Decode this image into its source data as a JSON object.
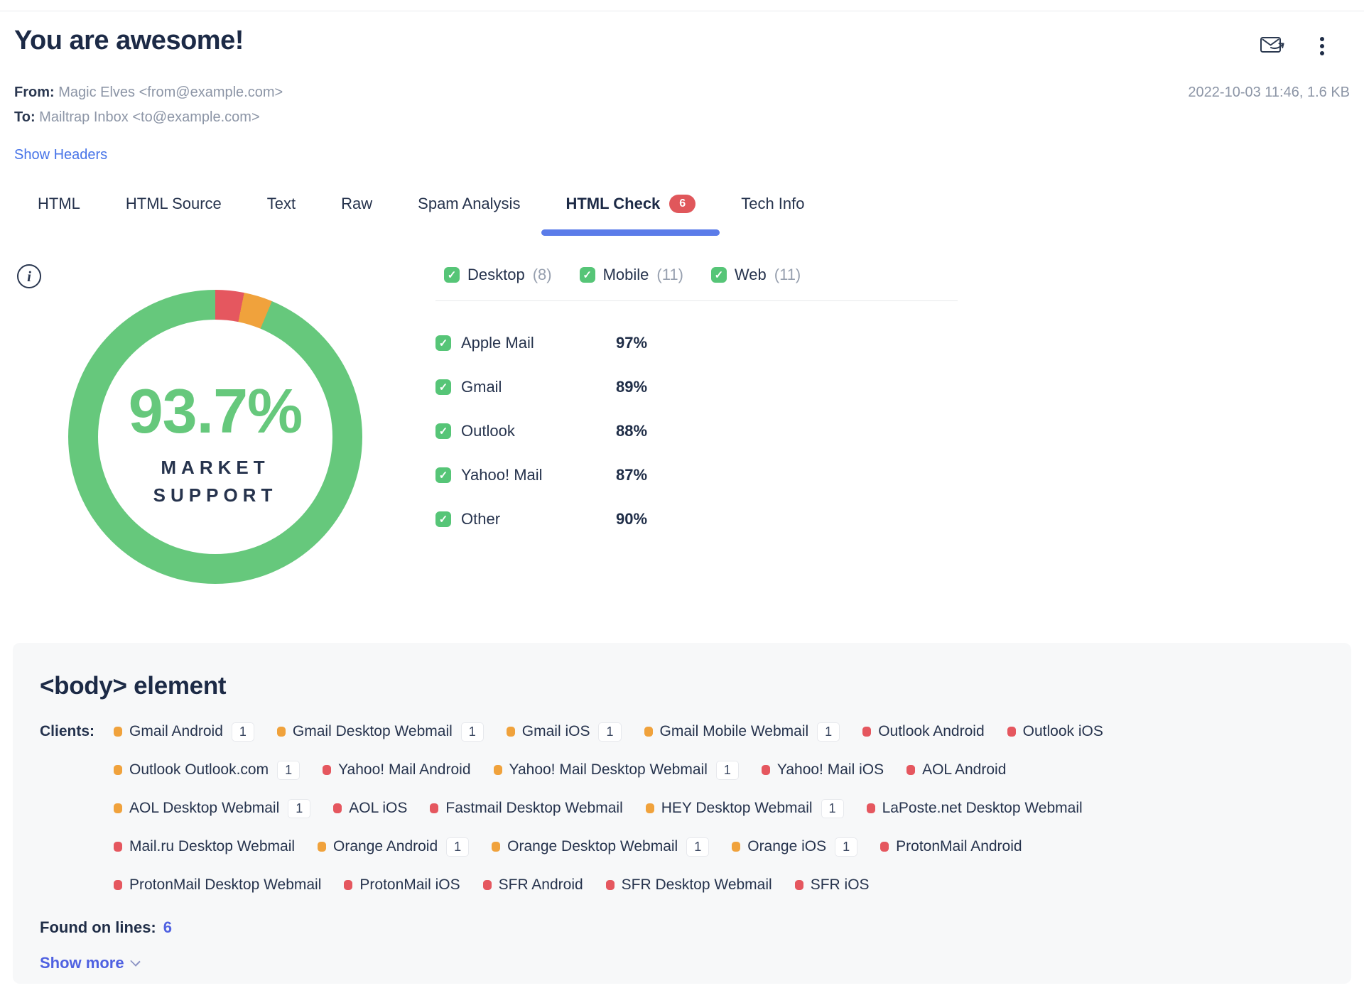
{
  "header": {
    "title": "You are awesome!",
    "from_label": "From:",
    "from_value": "Magic Elves <from@example.com>",
    "to_label": "To:",
    "to_value": "Mailtrap Inbox <to@example.com>",
    "show_headers_link": "Show Headers",
    "timestamp": "2022-10-03 11:46, 1.6 KB"
  },
  "tabs": [
    {
      "label": "HTML",
      "active": false
    },
    {
      "label": "HTML Source",
      "active": false
    },
    {
      "label": "Text",
      "active": false
    },
    {
      "label": "Raw",
      "active": false
    },
    {
      "label": "Spam Analysis",
      "active": false
    },
    {
      "label": "HTML Check",
      "badge": "6",
      "active": true
    },
    {
      "label": "Tech Info",
      "active": false
    }
  ],
  "html_check": {
    "filters": [
      {
        "label": "Desktop",
        "count": "(8)",
        "checked": true
      },
      {
        "label": "Mobile",
        "count": "(11)",
        "checked": true
      },
      {
        "label": "Web",
        "count": "(11)",
        "checked": true
      }
    ],
    "support_list": [
      {
        "label": "Apple Mail",
        "checked": true,
        "value": "97%"
      },
      {
        "label": "Gmail",
        "checked": true,
        "value": "89%"
      },
      {
        "label": "Outlook",
        "checked": true,
        "value": "88%"
      },
      {
        "label": "Yahoo! Mail",
        "checked": true,
        "value": "87%"
      },
      {
        "label": "Other",
        "checked": true,
        "value": "90%"
      }
    ]
  },
  "chart_data": {
    "type": "pie",
    "title": "Market support donut",
    "center_value": "93.7%",
    "center_label": "MARKET SUPPORT",
    "start_angle_deg": 0,
    "segments": [
      {
        "name": "unsupported",
        "color": "#e5575f",
        "percent": 3.15
      },
      {
        "name": "partial-support",
        "color": "#f0a23c",
        "percent": 3.15
      },
      {
        "name": "supported",
        "color": "#66c87c",
        "percent": 93.7
      }
    ]
  },
  "body_card": {
    "title": "<body> element",
    "clients_label": "Clients:",
    "tag_rows": [
      [
        {
          "name": "Gmail Android",
          "status": "warning",
          "count": "1"
        },
        {
          "name": "Gmail Desktop Webmail",
          "status": "warning",
          "count": "1"
        },
        {
          "name": "Gmail iOS",
          "status": "warning",
          "count": "1"
        },
        {
          "name": "Gmail Mobile Webmail",
          "status": "warning",
          "count": "1"
        },
        {
          "name": "Outlook Android",
          "status": "error"
        },
        {
          "name": "Outlook iOS",
          "status": "error"
        }
      ],
      [
        {
          "name": "Outlook Outlook.com",
          "status": "warning",
          "count": "1"
        },
        {
          "name": "Yahoo! Mail Android",
          "status": "error"
        },
        {
          "name": "Yahoo! Mail Desktop Webmail",
          "status": "warning",
          "count": "1"
        },
        {
          "name": "Yahoo! Mail iOS",
          "status": "error"
        },
        {
          "name": "AOL Android",
          "status": "error"
        }
      ],
      [
        {
          "name": "AOL Desktop Webmail",
          "status": "warning",
          "count": "1"
        },
        {
          "name": "AOL iOS",
          "status": "error"
        },
        {
          "name": "Fastmail Desktop Webmail",
          "status": "error"
        },
        {
          "name": "HEY Desktop Webmail",
          "status": "warning",
          "count": "1"
        },
        {
          "name": "LaPoste.net Desktop Webmail",
          "status": "error"
        }
      ],
      [
        {
          "name": "Mail.ru Desktop Webmail",
          "status": "error"
        },
        {
          "name": "Orange Android",
          "status": "warning",
          "count": "1"
        },
        {
          "name": "Orange Desktop Webmail",
          "status": "warning",
          "count": "1"
        },
        {
          "name": "Orange iOS",
          "status": "warning",
          "count": "1"
        },
        {
          "name": "ProtonMail Android",
          "status": "error"
        }
      ],
      [
        {
          "name": "ProtonMail Desktop Webmail",
          "status": "error"
        },
        {
          "name": "ProtonMail iOS",
          "status": "error"
        },
        {
          "name": "SFR Android",
          "status": "error"
        },
        {
          "name": "SFR Desktop Webmail",
          "status": "error"
        },
        {
          "name": "SFR iOS",
          "status": "error"
        }
      ]
    ],
    "found_on_lines_label": "Found on lines:",
    "found_on_lines_value": "6",
    "show_more_label": "Show more"
  },
  "colors": {
    "dark_navy": "#1c2a46",
    "gray_text": "#8c95a6",
    "link_blue": "#4673e8",
    "accent_indigo": "#4f61e1",
    "tab_underline": "#5b7ce9",
    "badge_red": "#e0575b",
    "green": "#66c87c",
    "checkbox_green": "#56c577",
    "warning_orange": "#f0a23c",
    "error_red": "#e5575f",
    "card_bg": "#f7f8f9",
    "divider": "#e8eaec"
  }
}
